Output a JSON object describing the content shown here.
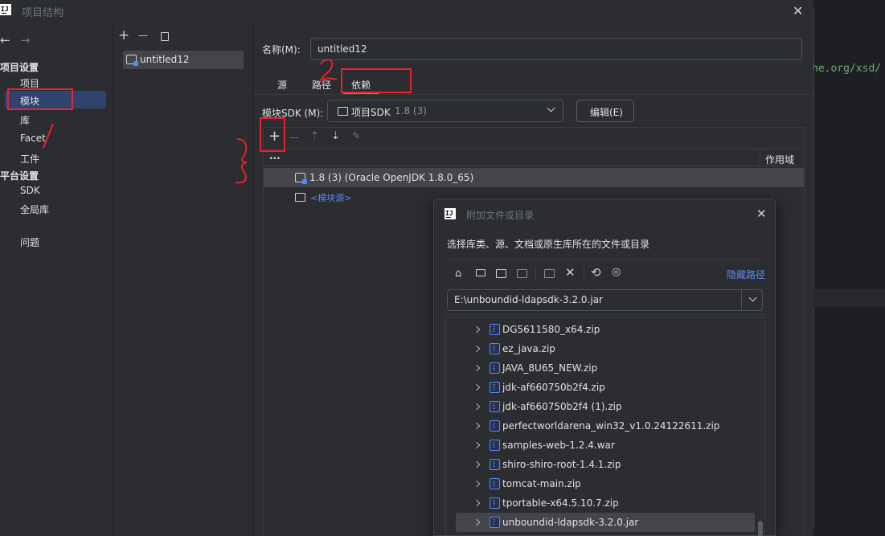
{
  "window": {
    "title": "项目结构",
    "close_icon": "close-icon"
  },
  "editor": {
    "code_snippet": "he.org/xsd/"
  },
  "nav": {
    "back": "←",
    "forward": "→",
    "project_settings": "项目设置",
    "items_project": [
      "项目",
      "模块",
      "库",
      "Facet",
      "工件"
    ],
    "platform_settings": "平台设置",
    "items_platform": [
      "SDK",
      "全局库"
    ],
    "problems": "问题"
  },
  "modules": {
    "toolbar": {
      "add": "+",
      "remove": "—",
      "copy": "copy-icon"
    },
    "items": [
      "untitled12"
    ]
  },
  "module": {
    "name_label": "名称(M):",
    "name_value": "untitled12",
    "tabs": [
      "源",
      "路径",
      "依赖"
    ],
    "sdk_label": "模块SDK (M):",
    "sdk_value": "项目SDK",
    "sdk_version": "1.8 (3)",
    "edit_button": "编辑(E)"
  },
  "deps": {
    "toolbar": {
      "add": "+",
      "remove": "—",
      "up": "up-icon",
      "down": "down-icon",
      "edit": "pencil-icon"
    },
    "columns": {
      "first": "...",
      "scope": "作用域"
    },
    "rows": [
      "1.8 (3) (Oracle OpenJDK 1.8.0_65)",
      "<模块源>"
    ]
  },
  "dialog": {
    "title": "附加文件或目录",
    "description": "选择库类、源、文档或原生库所在的文件或目录",
    "hide_path": "隐藏路径",
    "path_value": "E:\\unboundid-ldapsdk-3.2.0.jar",
    "files": [
      "DG5611580_x64.zip",
      "ez_java.zip",
      "JAVA_8U65_NEW.zip",
      "jdk-af660750b2f4.zip",
      "jdk-af660750b2f4 (1).zip",
      "perfectworldarena_win32_v1.0.24122611.zip",
      "samples-web-1.2.4.war",
      "shiro-shiro-root-1.4.1.zip",
      "tomcat-main.zip",
      "tportable-x64.5.10.7.zip",
      "unboundid-ldapsdk-3.2.0.jar"
    ],
    "selected_index": 10
  },
  "colors": {
    "accent": "#548af7",
    "annotation_red": "#e8222e",
    "selected_bg": "#2e436e"
  }
}
